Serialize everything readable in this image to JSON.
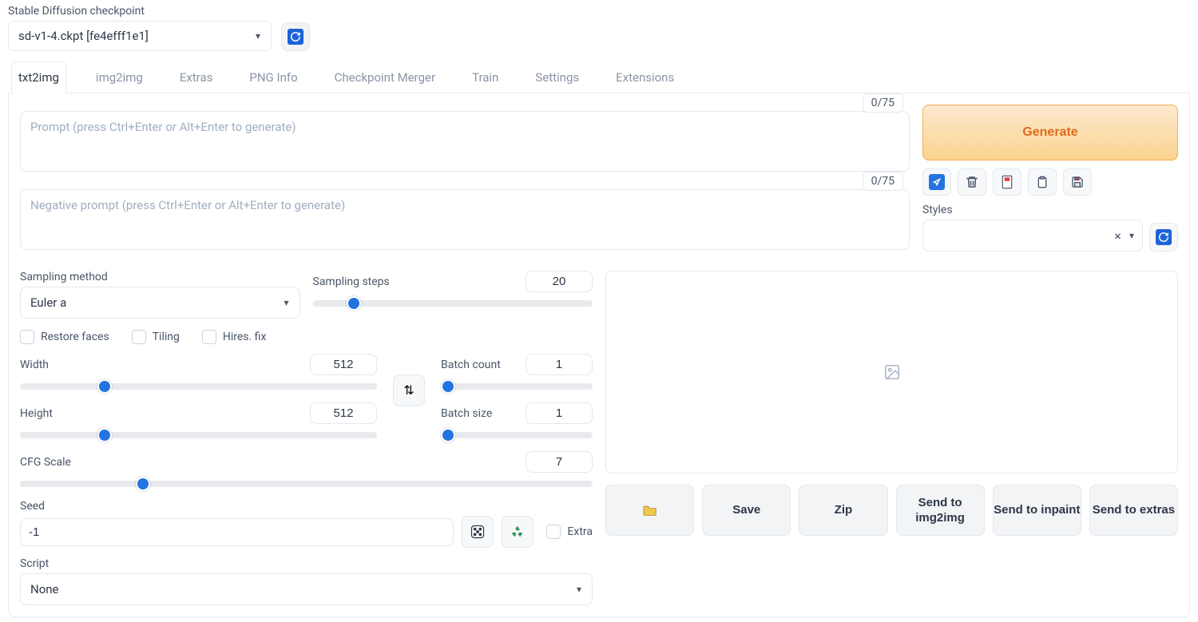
{
  "top": {
    "checkpoint_label": "Stable Diffusion checkpoint",
    "checkpoint_value": "sd-v1-4.ckpt [fe4efff1e1]"
  },
  "tabs": [
    "txt2img",
    "img2img",
    "Extras",
    "PNG Info",
    "Checkpoint Merger",
    "Train",
    "Settings",
    "Extensions"
  ],
  "active_tab": 0,
  "prompt": {
    "counter": "0/75",
    "placeholder": "Prompt (press Ctrl+Enter or Alt+Enter to generate)",
    "value": ""
  },
  "neg_prompt": {
    "counter": "0/75",
    "placeholder": "Negative prompt (press Ctrl+Enter or Alt+Enter to generate)",
    "value": ""
  },
  "generate_label": "Generate",
  "styles_label": "Styles",
  "sampling": {
    "method_label": "Sampling method",
    "method_value": "Euler a",
    "steps_label": "Sampling steps",
    "steps_value": "20",
    "steps_min": 1,
    "steps_max": 150
  },
  "checks": {
    "restore": "Restore faces",
    "tiling": "Tiling",
    "hires": "Hires. fix"
  },
  "dims": {
    "width_label": "Width",
    "width_value": "512",
    "height_label": "Height",
    "height_value": "512",
    "min": 64,
    "max": 2048
  },
  "batch": {
    "count_label": "Batch count",
    "count_value": "1",
    "size_label": "Batch size",
    "size_value": "1"
  },
  "cfg": {
    "label": "CFG Scale",
    "value": "7",
    "min": 1,
    "max": 30
  },
  "seed": {
    "label": "Seed",
    "value": "-1",
    "extra_label": "Extra"
  },
  "script": {
    "label": "Script",
    "value": "None"
  },
  "send": {
    "save": "Save",
    "zip": "Zip",
    "img2img": "Send to img2img",
    "inpaint": "Send to inpaint",
    "extras": "Send to extras"
  }
}
